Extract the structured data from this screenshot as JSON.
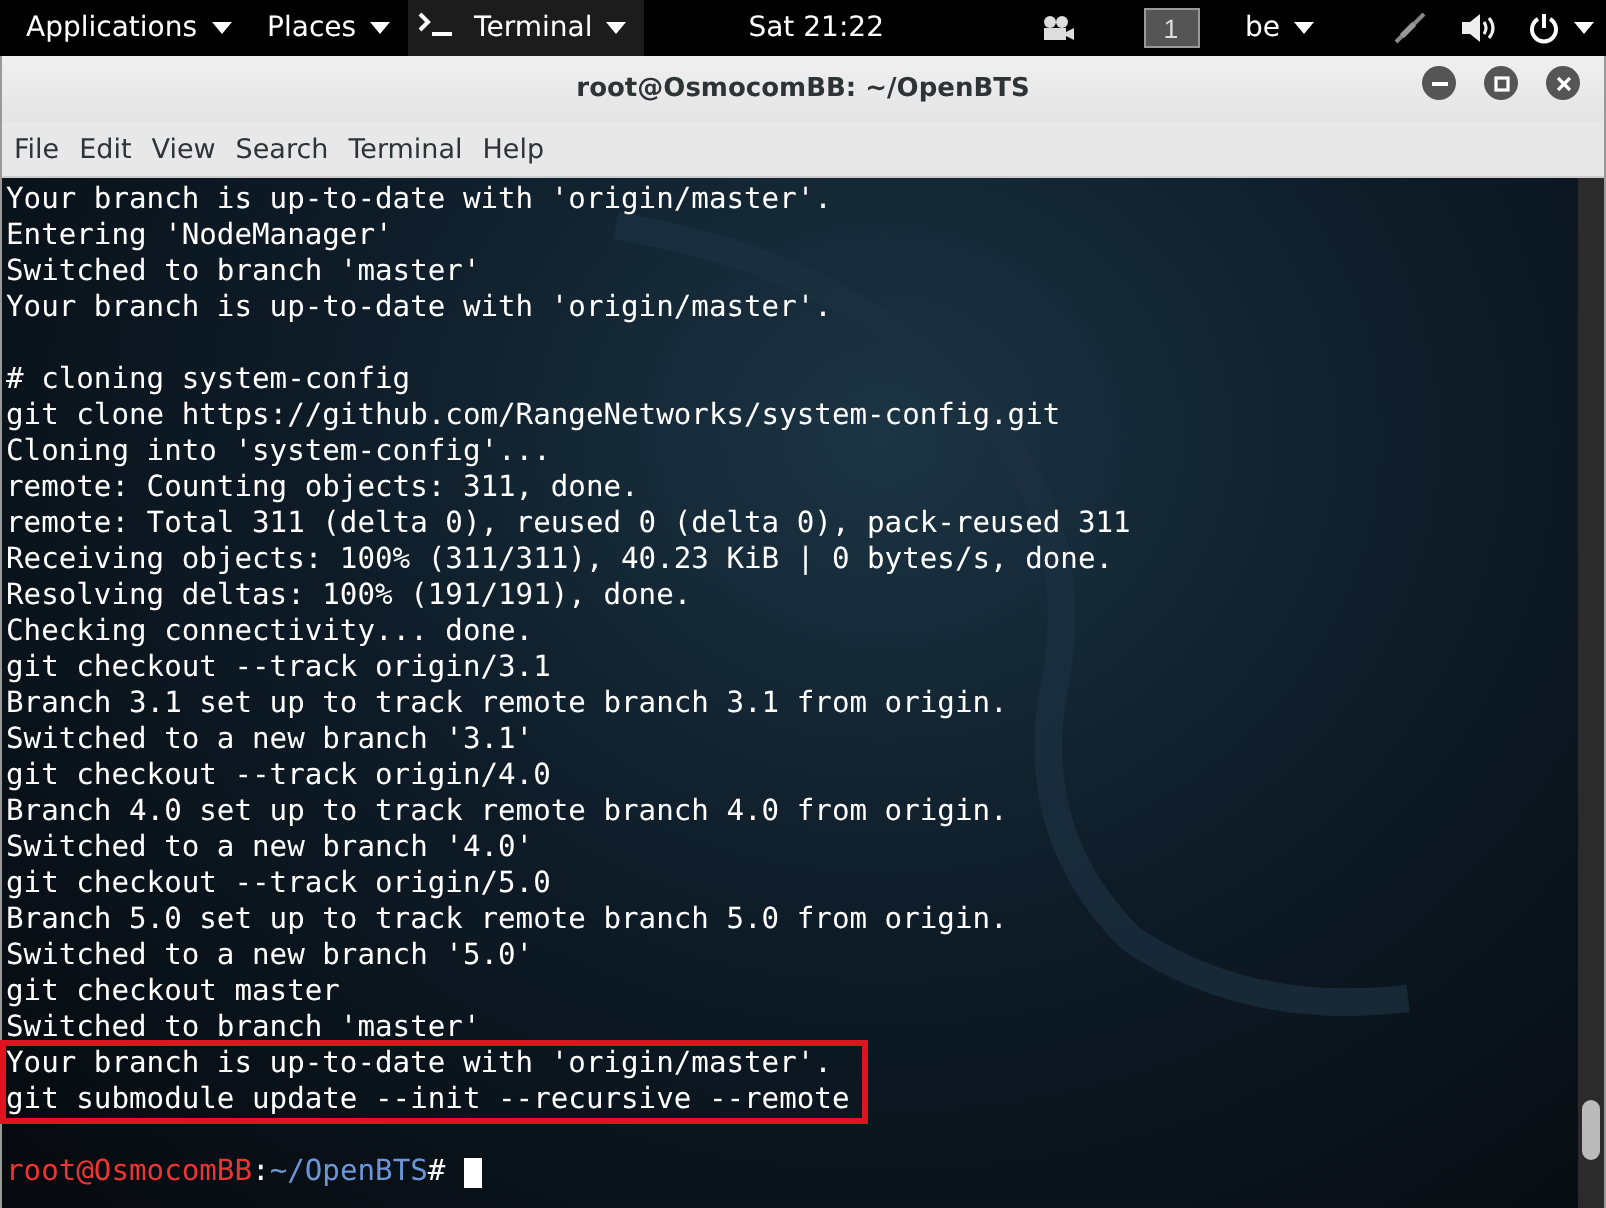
{
  "top_bar": {
    "menus": [
      {
        "label": "Applications",
        "kind": "menu"
      },
      {
        "label": "Places",
        "kind": "menu"
      },
      {
        "label": "Terminal",
        "kind": "app"
      }
    ],
    "clock": "Sat 21:22",
    "workspace": "1",
    "keyboard_layout": "be"
  },
  "window": {
    "title": "root@OsmocomBB: ~/OpenBTS"
  },
  "menu_bar": [
    "File",
    "Edit",
    "View",
    "Search",
    "Terminal",
    "Help"
  ],
  "terminal": {
    "blocks": [
      {
        "lines": [
          {
            "text": "Your branch is up-to-date with 'origin/master'.",
            "highlighted": false
          },
          {
            "text": "Entering 'NodeManager'",
            "highlighted": false
          },
          {
            "text": "Switched to branch 'master'",
            "highlighted": false
          },
          {
            "text": "Your branch is up-to-date with 'origin/master'.",
            "highlighted": false
          }
        ]
      },
      {
        "lines": [
          {
            "text": "# cloning system-config",
            "highlighted": false
          },
          {
            "text": "git clone https://github.com/RangeNetworks/system-config.git",
            "highlighted": false
          },
          {
            "text": "Cloning into 'system-config'...",
            "highlighted": false
          },
          {
            "text": "remote: Counting objects: 311, done.",
            "highlighted": false
          },
          {
            "text": "remote: Total 311 (delta 0), reused 0 (delta 0), pack-reused 311",
            "highlighted": false
          },
          {
            "text": "Receiving objects: 100% (311/311), 40.23 KiB | 0 bytes/s, done.",
            "highlighted": false
          },
          {
            "text": "Resolving deltas: 100% (191/191), done.",
            "highlighted": false
          },
          {
            "text": "Checking connectivity... done.",
            "highlighted": false
          },
          {
            "text": "git checkout --track origin/3.1",
            "highlighted": false
          },
          {
            "text": "Branch 3.1 set up to track remote branch 3.1 from origin.",
            "highlighted": false
          },
          {
            "text": "Switched to a new branch '3.1'",
            "highlighted": false
          },
          {
            "text": "git checkout --track origin/4.0",
            "highlighted": false
          },
          {
            "text": "Branch 4.0 set up to track remote branch 4.0 from origin.",
            "highlighted": false
          },
          {
            "text": "Switched to a new branch '4.0'",
            "highlighted": false
          },
          {
            "text": "git checkout --track origin/5.0",
            "highlighted": false
          },
          {
            "text": "Branch 5.0 set up to track remote branch 5.0 from origin.",
            "highlighted": false
          },
          {
            "text": "Switched to a new branch '5.0'",
            "highlighted": false
          },
          {
            "text": "git checkout master",
            "highlighted": false
          },
          {
            "text": "Switched to branch 'master'",
            "highlighted": false
          },
          {
            "text": "Your branch is up-to-date with 'origin/master'.",
            "highlighted": true
          },
          {
            "text": "git submodule update --init --recursive --remote",
            "highlighted": true
          }
        ]
      }
    ],
    "prompt": {
      "user_host": "root@OsmocomBB",
      "separator": ":",
      "path": "~/OpenBTS",
      "symbol": "#"
    }
  }
}
